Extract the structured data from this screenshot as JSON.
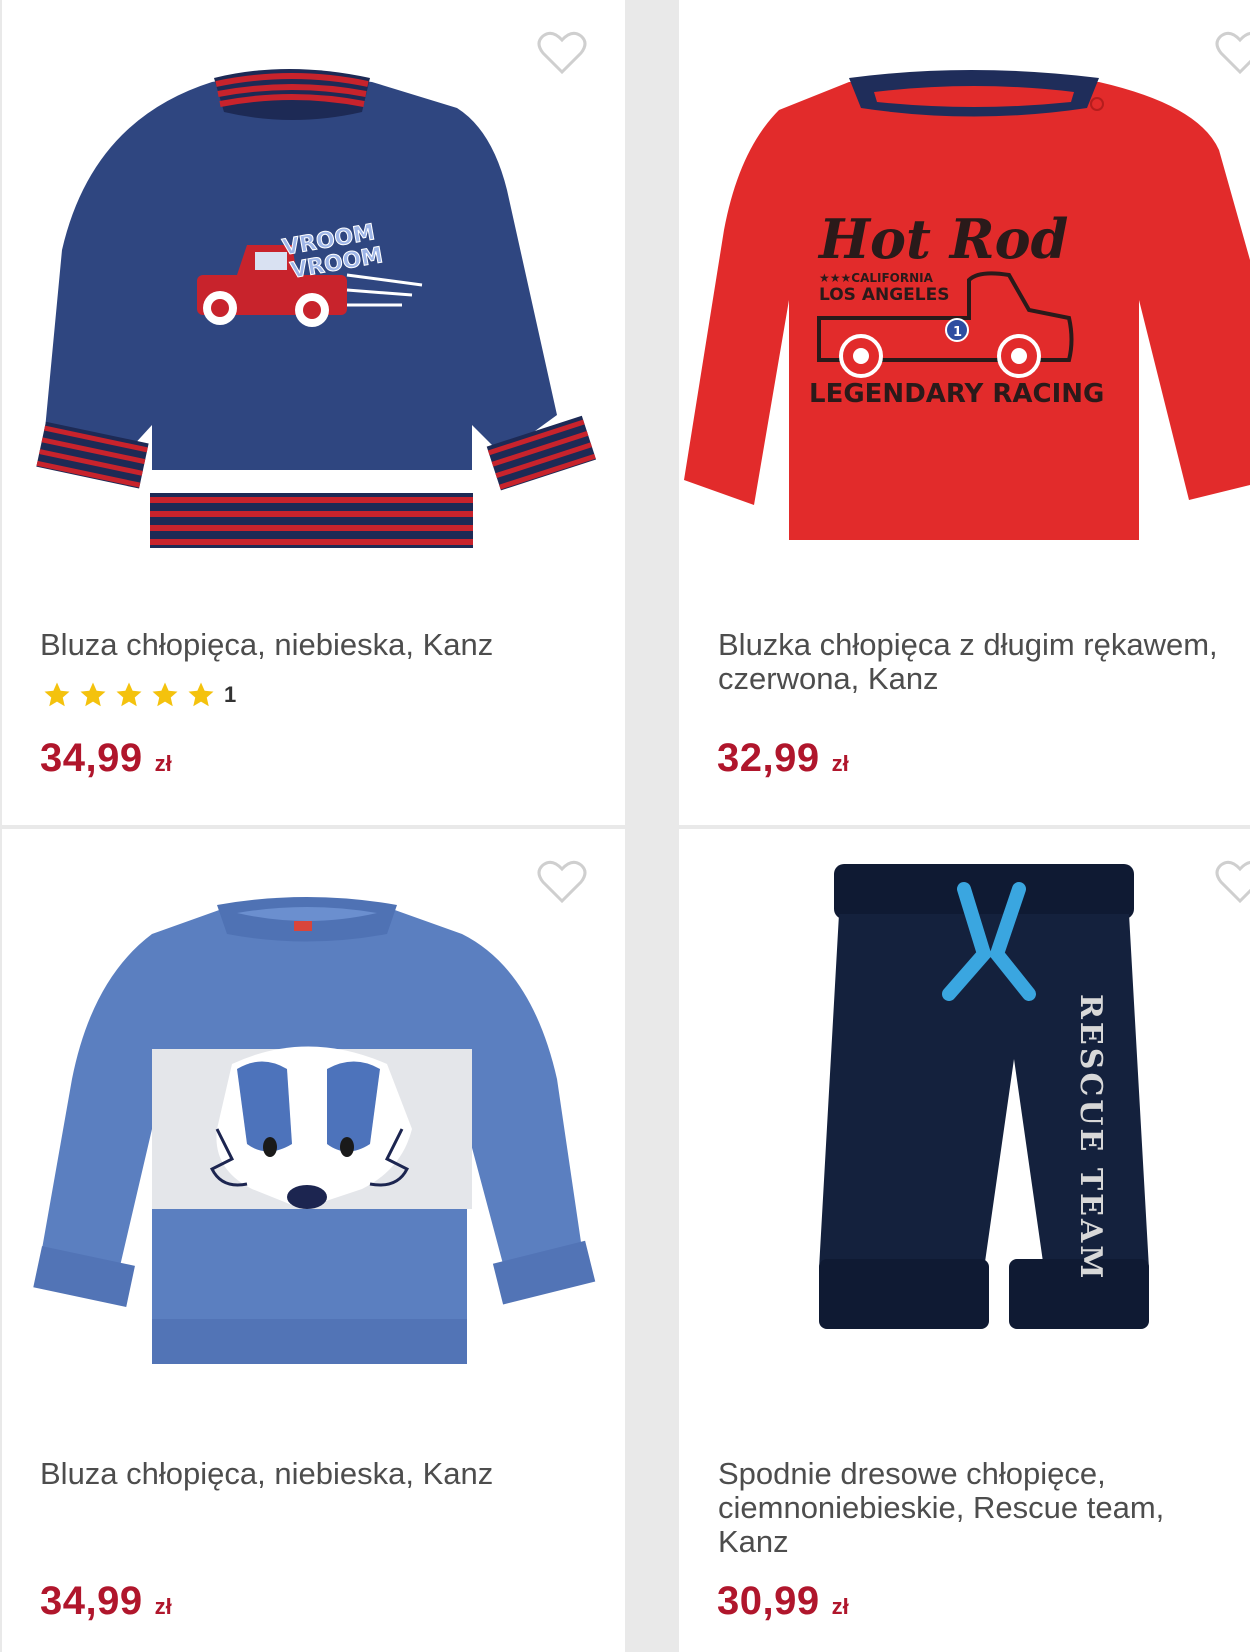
{
  "colors": {
    "price": "#b0162c",
    "star": "#f4c20d",
    "card_bg": "#ffffff",
    "page_bg": "#e9e9e9"
  },
  "products": [
    {
      "title": "Bluza chłopięca, niebieska, Kanz",
      "rating_stars": 5,
      "rating_count": "1",
      "price": "34,99",
      "currency": "zł",
      "image": "navy-sweatshirt-red-truck",
      "image_text": [
        "VROOM",
        "VROOM"
      ],
      "favorite_icon": "heart-outline-icon"
    },
    {
      "title": "Bluzka chłopięca z długim rękawem, czerwona, Kanz",
      "price": "32,99",
      "currency": "zł",
      "image": "red-longsleeve-hot-rod",
      "image_text": [
        "Hot Rod",
        "★★★CALIFORNIA",
        "LOS ANGELES",
        "LEGENDARY RACING",
        "1"
      ],
      "favorite_icon": "heart-outline-icon"
    },
    {
      "title": "Bluza chłopięca, niebieska, Kanz",
      "price": "34,99",
      "currency": "zł",
      "image": "blue-sweatshirt-badger",
      "favorite_icon": "heart-outline-icon"
    },
    {
      "title": "Spodnie dresowe chłopięce, ciemnoniebieskie, Rescue team, Kanz",
      "price": "30,99",
      "currency": "zł",
      "image": "navy-sweatpants-rescue-team",
      "image_text": [
        "RESCUE TEAM"
      ],
      "favorite_icon": "heart-outline-icon"
    }
  ]
}
